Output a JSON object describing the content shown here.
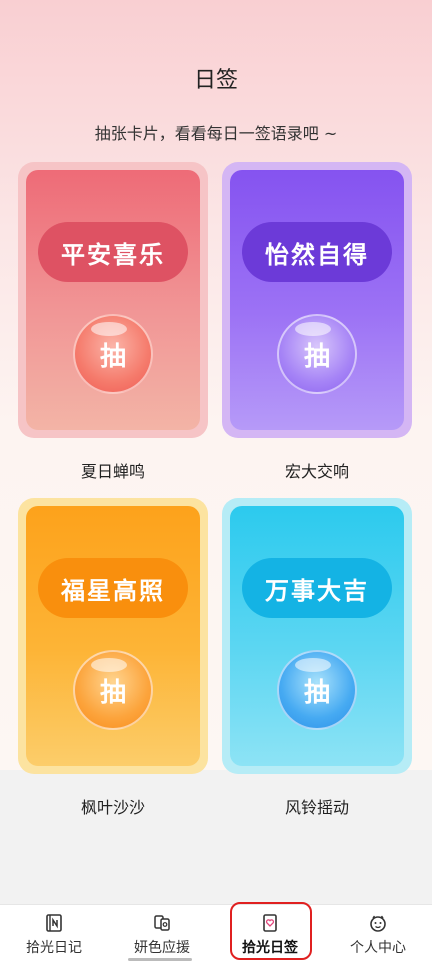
{
  "header": {
    "title": "日签",
    "subtitle": "抽张卡片，看看每日一签语录吧 ~"
  },
  "cards": [
    {
      "badge": "平安喜乐",
      "button": "抽",
      "label": "夏日蝉鸣",
      "color": "#ee6b77"
    },
    {
      "badge": "怡然自得",
      "button": "抽",
      "label": "宏大交响",
      "color": "#8553f0"
    },
    {
      "badge": "福星高照",
      "button": "抽",
      "label": "枫叶沙沙",
      "color": "#fda21b"
    },
    {
      "badge": "万事大吉",
      "button": "抽",
      "label": "风铃摇动",
      "color": "#2ccaee"
    }
  ],
  "tabbar": {
    "items": [
      {
        "label": "拾光日记",
        "icon": "notebook-icon"
      },
      {
        "label": "妍色应援",
        "icon": "cheer-icon"
      },
      {
        "label": "拾光日签",
        "icon": "sign-card-icon",
        "active": true
      },
      {
        "label": "个人中心",
        "icon": "profile-face-icon"
      }
    ],
    "active_outline_color": "#e02020"
  }
}
